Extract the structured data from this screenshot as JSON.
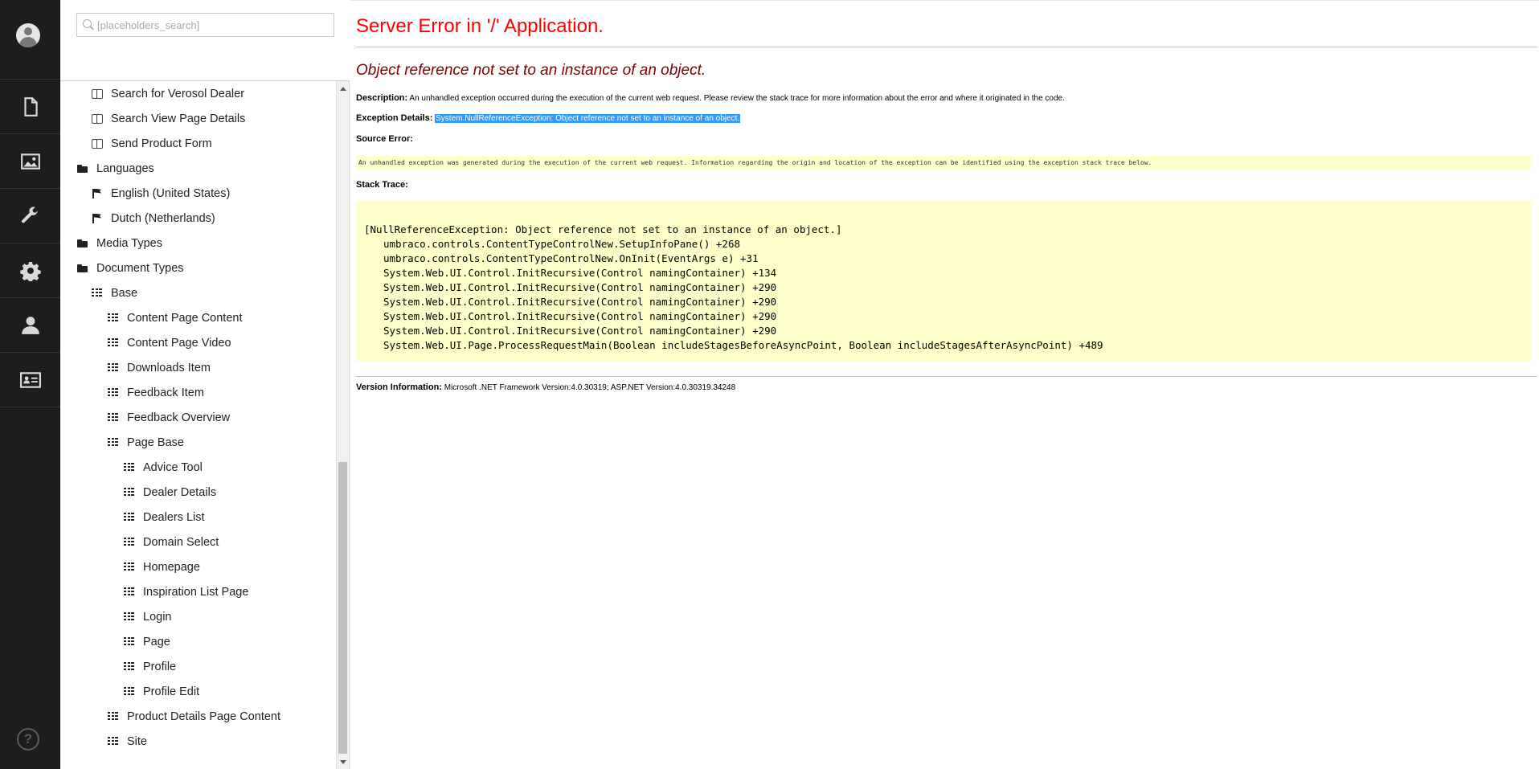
{
  "sections": [
    {
      "name": "content",
      "icon": "document-icon"
    },
    {
      "name": "media",
      "icon": "image-icon"
    },
    {
      "name": "settings",
      "icon": "wrench-icon"
    },
    {
      "name": "developer",
      "icon": "gear-icon"
    },
    {
      "name": "users",
      "icon": "user-icon"
    },
    {
      "name": "members",
      "icon": "id-card-icon"
    }
  ],
  "search": {
    "placeholder": "[placeholders_search]"
  },
  "tree": [
    {
      "label": "Search for Verosol Dealer",
      "icon": "book-icon",
      "level": 2
    },
    {
      "label": "Search View Page Details",
      "icon": "book-icon",
      "level": 2
    },
    {
      "label": "Send Product Form",
      "icon": "book-icon",
      "level": 2
    },
    {
      "label": "Languages",
      "icon": "folder-icon",
      "level": 1
    },
    {
      "label": "English (United States)",
      "icon": "flag-icon",
      "level": 2
    },
    {
      "label": "Dutch (Netherlands)",
      "icon": "flag-icon",
      "level": 2
    },
    {
      "label": "Media Types",
      "icon": "folder-icon",
      "level": 1
    },
    {
      "label": "Document Types",
      "icon": "folder-icon",
      "level": 1
    },
    {
      "label": "Base",
      "icon": "grid-icon",
      "level": 2
    },
    {
      "label": "Content Page Content",
      "icon": "grid-icon",
      "level": 3
    },
    {
      "label": "Content Page Video",
      "icon": "grid-icon",
      "level": 3
    },
    {
      "label": "Downloads Item",
      "icon": "grid-icon",
      "level": 3
    },
    {
      "label": "Feedback Item",
      "icon": "grid-icon",
      "level": 3
    },
    {
      "label": "Feedback Overview",
      "icon": "grid-icon",
      "level": 3
    },
    {
      "label": "Page Base",
      "icon": "grid-icon",
      "level": 3
    },
    {
      "label": "Advice Tool",
      "icon": "grid-icon",
      "level": 4
    },
    {
      "label": "Dealer Details",
      "icon": "grid-icon",
      "level": 4
    },
    {
      "label": "Dealers List",
      "icon": "grid-icon",
      "level": 4
    },
    {
      "label": "Domain Select",
      "icon": "grid-icon",
      "level": 4
    },
    {
      "label": "Homepage",
      "icon": "grid-icon",
      "level": 4
    },
    {
      "label": "Inspiration List Page",
      "icon": "grid-icon",
      "level": 4
    },
    {
      "label": "Login",
      "icon": "grid-icon",
      "level": 4
    },
    {
      "label": "Page",
      "icon": "grid-icon",
      "level": 4
    },
    {
      "label": "Profile",
      "icon": "grid-icon",
      "level": 4
    },
    {
      "label": "Profile Edit",
      "icon": "grid-icon",
      "level": 4
    },
    {
      "label": "Product Details Page Content",
      "icon": "grid-icon",
      "level": 3
    },
    {
      "label": "Site",
      "icon": "grid-icon",
      "level": 3
    }
  ],
  "error": {
    "title": "Server Error in '/' Application.",
    "subtitle": "Object reference not set to an instance of an object.",
    "description_label": "Description:",
    "description_text": "An unhandled exception occurred during the execution of the current web request. Please review the stack trace for more information about the error and where it originated in the code.",
    "exception_label": "Exception Details:",
    "exception_text": "System.NullReferenceException: Object reference not set to an instance of an object.",
    "source_label": "Source Error:",
    "source_text": "An unhandled exception was generated during the execution of the current web request. Information regarding the origin and location of the exception can be identified using the exception stack trace below.",
    "stack_label": "Stack Trace:",
    "stack_head": "[NullReferenceException: Object reference not set to an instance of an object.]",
    "stack_frames": [
      "umbraco.controls.ContentTypeControlNew.SetupInfoPane() +268",
      "umbraco.controls.ContentTypeControlNew.OnInit(EventArgs e) +31",
      "System.Web.UI.Control.InitRecursive(Control namingContainer) +134",
      "System.Web.UI.Control.InitRecursive(Control namingContainer) +290",
      "System.Web.UI.Control.InitRecursive(Control namingContainer) +290",
      "System.Web.UI.Control.InitRecursive(Control namingContainer) +290",
      "System.Web.UI.Control.InitRecursive(Control namingContainer) +290",
      "System.Web.UI.Page.ProcessRequestMain(Boolean includeStagesBeforeAsyncPoint, Boolean includeStagesAfterAsyncPoint) +489"
    ],
    "version_label": "Version Information:",
    "version_text": "Microsoft .NET Framework Version:4.0.30319; ASP.NET Version:4.0.30319.34248"
  },
  "colors": {
    "sidebar": "#1d1d1d",
    "error_title": "#ff0000",
    "error_subtitle": "#800000",
    "code_bg": "#ffffcc",
    "selection": "#3399ff"
  }
}
